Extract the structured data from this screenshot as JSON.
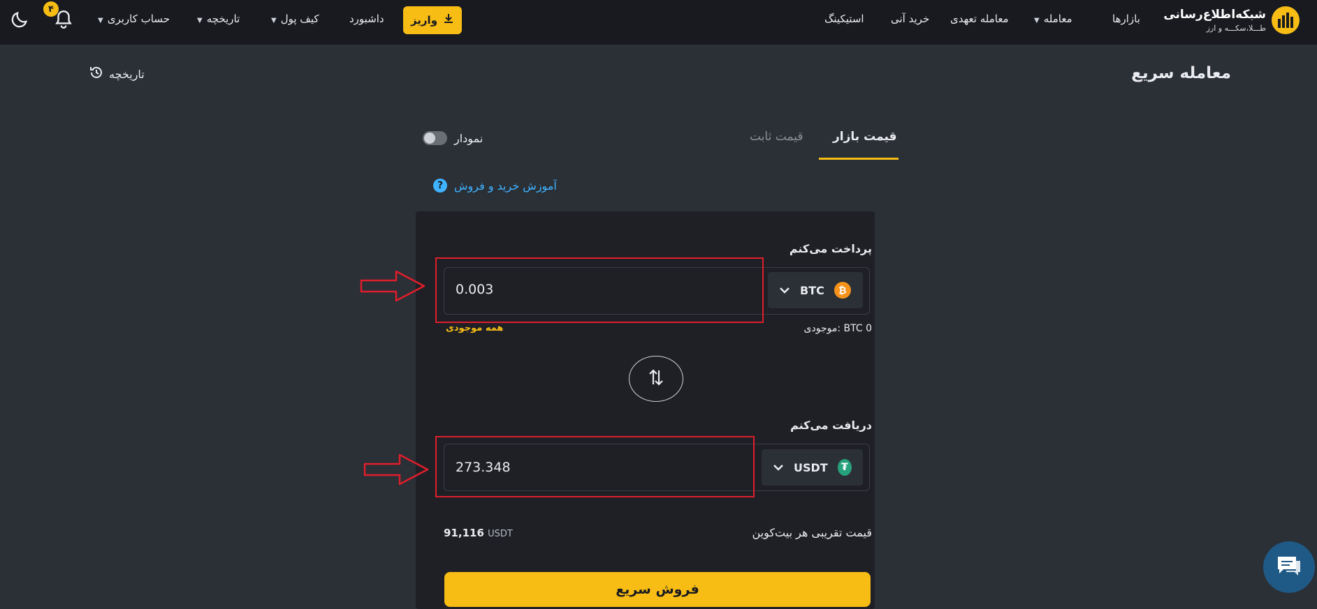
{
  "header": {
    "logo_title": "شبکه‌اطلاع‌رسانی",
    "logo_subtitle": "طـــلا،سکـــه و ارز",
    "nav_right": [
      "بازارها",
      "معامله",
      "معامله تعهدی",
      "خرید آنی",
      "استیکینگ"
    ],
    "nav_left": {
      "deposit": "واریز",
      "dashboard": "داشبورد",
      "wallet": "کیف پول",
      "history": "تاریخچه",
      "account": "حساب کاربری"
    },
    "notification_count": "۴",
    "icons": [
      "moon-icon",
      "bell-icon",
      "download-icon"
    ]
  },
  "page": {
    "title": "معامله سریع",
    "history_link": "تاریخچه"
  },
  "tabs": {
    "market": "قیمت بازار",
    "fixed": "قیمت ثابت",
    "active": "قیمت بازار"
  },
  "chart_toggle": {
    "label": "نمودار",
    "state": "off"
  },
  "tutorial_link": "آموزش خرید و فروش",
  "pay": {
    "label": "پرداخت می‌کنم",
    "value": "0.003",
    "currency": "BTC",
    "balance_label": "موجودی:",
    "balance_value": "BTC 0",
    "all_balance": "همه موجودی"
  },
  "receive": {
    "label": "دریافت می‌کنم",
    "value": "273.348",
    "currency": "USDT"
  },
  "price": {
    "label": "قیمت تقریبی هر بیت‌کوین",
    "value": "91,116",
    "unit": "USDT"
  },
  "submit": "فروش سریع",
  "colors": {
    "accent": "#f8bd15",
    "background": "#2b2f36",
    "topbar": "#181a20",
    "card": "#1e2026",
    "annotation": "#e01e2b",
    "link": "#3fb3ff"
  }
}
